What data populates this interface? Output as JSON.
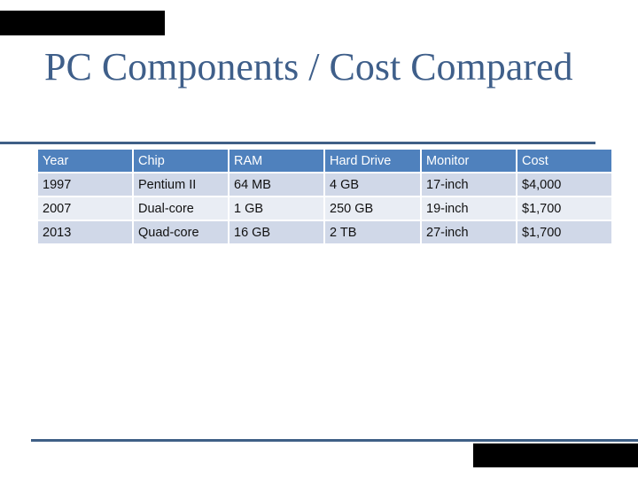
{
  "slide": {
    "title": "PC Components / Cost Compared"
  },
  "table": {
    "headers": [
      "Year",
      "Chip",
      "RAM",
      "Hard Drive",
      "Monitor",
      "Cost"
    ],
    "rows": [
      [
        "1997",
        "Pentium II",
        "64 MB",
        "4 GB",
        "17-inch",
        "$4,000"
      ],
      [
        "2007",
        "Dual-core",
        "1 GB",
        "250 GB",
        "19-inch",
        "$1,700"
      ],
      [
        "2013",
        "Quad-core",
        "16 GB",
        "2 TB",
        "27-inch",
        "$1,700"
      ]
    ]
  },
  "colors": {
    "title": "#3F5F8A",
    "rule": "#3F5F86",
    "header_bg": "#4F81BD",
    "row_odd_bg": "#D0D8E8",
    "row_even_bg": "#E9EDF4",
    "redaction": "#000000"
  }
}
